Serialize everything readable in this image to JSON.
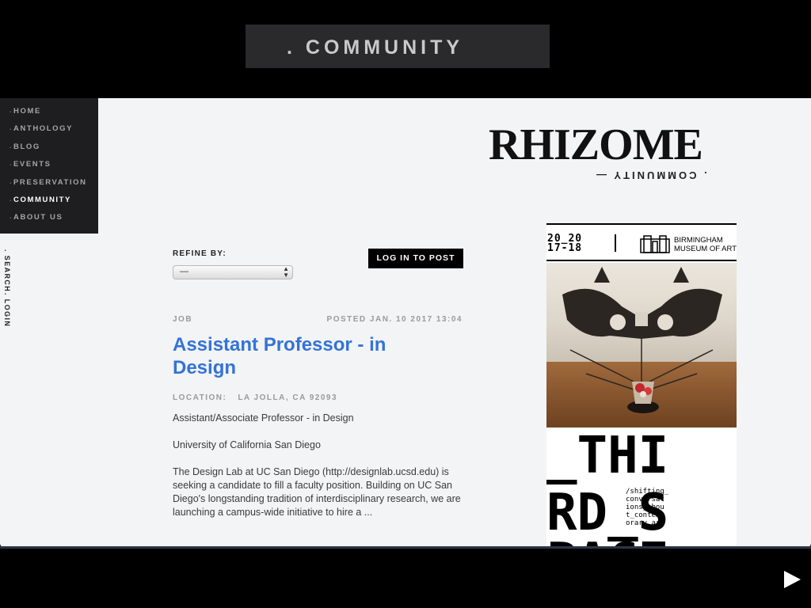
{
  "header": {
    "title": ". COMMUNITY"
  },
  "nav": {
    "items": [
      {
        "label": "HOME"
      },
      {
        "label": "ANTHOLOGY"
      },
      {
        "label": "BLOG"
      },
      {
        "label": "EVENTS"
      },
      {
        "label": "PRESERVATION"
      },
      {
        "label": "COMMUNITY"
      },
      {
        "label": "ABOUT US"
      }
    ]
  },
  "side_links": {
    "search": ". SEARCH",
    "login": ". LOGIN"
  },
  "logo": {
    "wordmark": "RHIZOME",
    "section": ". COMMUNITY —"
  },
  "refine": {
    "label": "REFINE BY:",
    "selected": "—"
  },
  "login_button": "LOG IN TO POST",
  "post": {
    "type": "JOB",
    "date": "POSTED JAN. 10 2017 13:04",
    "title": "Assistant Professor - in Design",
    "location_label": "LOCATION:",
    "location_value": "LA JOLLA, CA 92093",
    "p1": "Assistant/Associate Professor - in Design",
    "p2": "University of California San Diego",
    "p3": "The Design Lab at UC San Diego (http://designlab.ucsd.edu) is seeking a candidate to fill a faculty position. Building on UC San Diego's longstanding tradition of interdisciplinary research, we are launching a campus-wide initiative to hire a ..."
  },
  "ad": {
    "years_1": "20_20",
    "years_2": "17-18",
    "museum_1": "BIRMINGHAM",
    "museum_2": "MUSEUM OF ART",
    "big_1": "_THI",
    "big_2": "RD_S",
    "big_3": "PACE",
    "tagline": "/shifting_\nconversat\nions_abou\nt_contemp\norary_art"
  },
  "colors": {
    "accent": "#3473d6",
    "nav_bg": "#1e1e20",
    "panel_bg": "#f3f4f6"
  },
  "icons": {
    "play": "play-icon",
    "select_arrows": "chevron-updown-icon"
  }
}
